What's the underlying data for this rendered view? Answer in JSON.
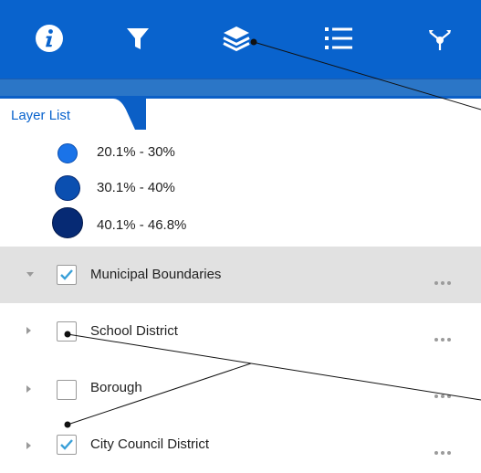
{
  "toolbar": {
    "tools": [
      {
        "name": "info-icon"
      },
      {
        "name": "filter-icon"
      },
      {
        "name": "layers-icon"
      },
      {
        "name": "list-icon"
      },
      {
        "name": "share-icon"
      }
    ],
    "background": "#0963cd"
  },
  "panel": {
    "tab_label": "Layer List"
  },
  "legend": {
    "items": [
      {
        "label": "20.1% - 30%",
        "color": "#1a73e8"
      },
      {
        "label": "30.1% - 40%",
        "color": "#0b4fb0"
      },
      {
        "label": "40.1% - 46.8%",
        "color": "#062a74"
      }
    ]
  },
  "layers": [
    {
      "label": "Municipal Boundaries",
      "checked": true,
      "expanded": true,
      "selected": true
    },
    {
      "label": "School District",
      "checked": false,
      "expanded": false,
      "selected": false
    },
    {
      "label": "Borough",
      "checked": false,
      "expanded": false,
      "selected": false
    },
    {
      "label": "City Council District",
      "checked": true,
      "expanded": false,
      "selected": false
    }
  ],
  "accent_check_color": "#3aa0d8"
}
